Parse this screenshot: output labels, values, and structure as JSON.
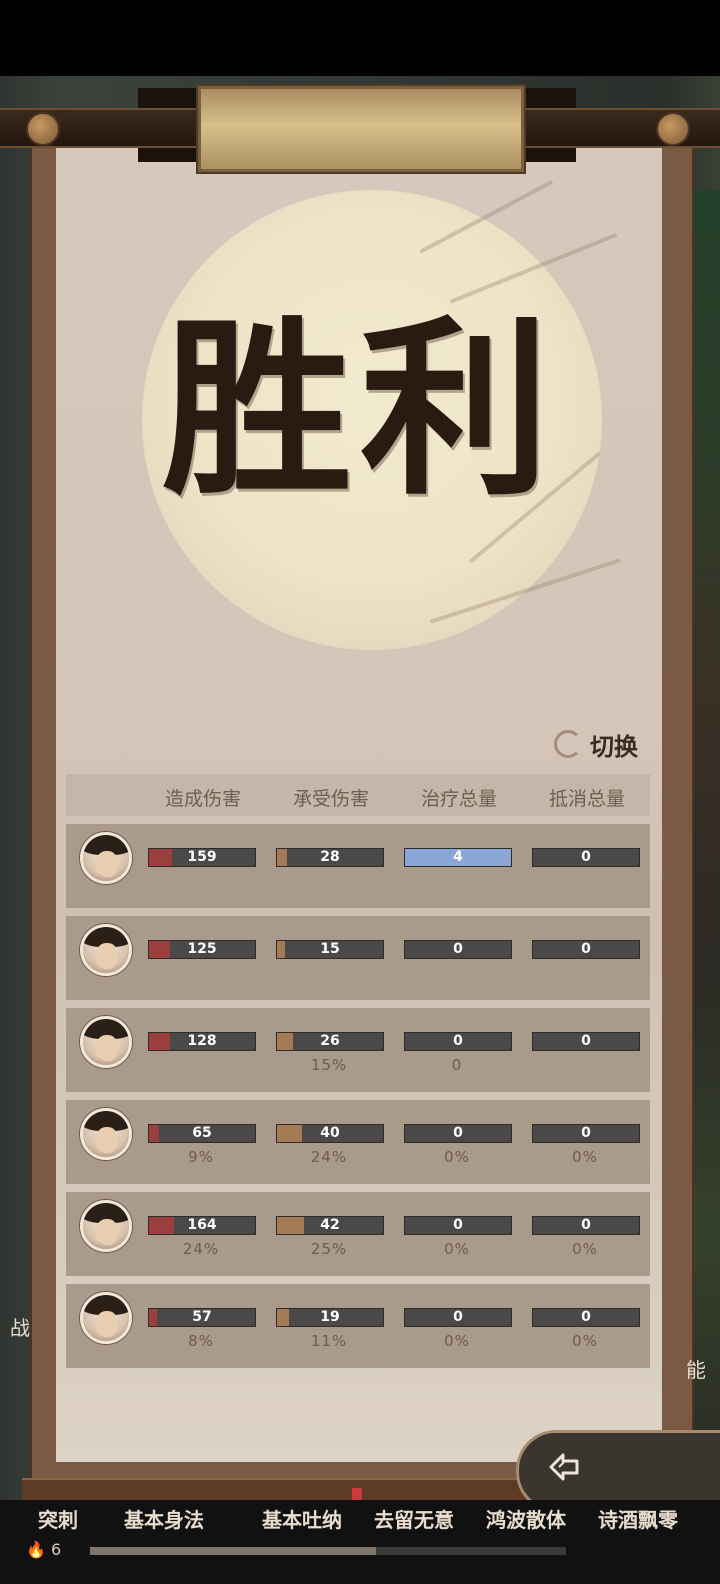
{
  "title": "胜利",
  "switch_label": "切换",
  "columns": [
    "造成伤害",
    "承受伤害",
    "治疗总量",
    "抵消总量"
  ],
  "colors": {
    "damage": "#9a3e3e",
    "taken": "#a57b56",
    "heal": "#8aa6d6",
    "shield": "#6f6f6f"
  },
  "rows": [
    {
      "name": "",
      "damage": "159",
      "taken": "28",
      "heal": "4",
      "shield": "0",
      "damage_pct": "",
      "taken_pct": "",
      "heal_pct": "",
      "shield_pct": "",
      "damage_fill": 0.22,
      "taken_fill": 0.09,
      "heal_fill": 1.0,
      "shield_fill": 0
    },
    {
      "name": "",
      "damage": "125",
      "taken": "15",
      "heal": "0",
      "shield": "0",
      "damage_pct": "",
      "taken_pct": "",
      "heal_pct": "",
      "shield_pct": "",
      "damage_fill": 0.2,
      "taken_fill": 0.08,
      "heal_fill": 0,
      "shield_fill": 0
    },
    {
      "name": "",
      "damage": "128",
      "taken": "26",
      "heal": "0",
      "shield": "0",
      "damage_pct": "",
      "taken_pct": "15%",
      "heal_pct": "0",
      "shield_pct": "",
      "damage_fill": 0.2,
      "taken_fill": 0.15,
      "heal_fill": 0,
      "shield_fill": 0
    },
    {
      "name": "",
      "damage": "65",
      "taken": "40",
      "heal": "0",
      "shield": "0",
      "damage_pct": "9%",
      "taken_pct": "24%",
      "heal_pct": "0%",
      "shield_pct": "0%",
      "damage_fill": 0.09,
      "taken_fill": 0.24,
      "heal_fill": 0,
      "shield_fill": 0
    },
    {
      "name": "",
      "damage": "164",
      "taken": "42",
      "heal": "0",
      "shield": "0",
      "damage_pct": "24%",
      "taken_pct": "25%",
      "heal_pct": "0%",
      "shield_pct": "0%",
      "damage_fill": 0.24,
      "taken_fill": 0.25,
      "heal_fill": 0,
      "shield_fill": 0
    },
    {
      "name": "",
      "damage": "57",
      "taken": "19",
      "heal": "0",
      "shield": "0",
      "damage_pct": "8%",
      "taken_pct": "11%",
      "heal_pct": "0%",
      "shield_pct": "0%",
      "damage_fill": 0.08,
      "taken_fill": 0.11,
      "heal_fill": 0,
      "shield_fill": 0
    }
  ],
  "skills": [
    "突刺",
    "基本身法",
    "基本吐纳",
    "去留无意",
    "鸿波散体",
    "诗酒飘零"
  ],
  "level": "6",
  "exp_fill": 0.6,
  "side_left": "战",
  "side_right": "能"
}
